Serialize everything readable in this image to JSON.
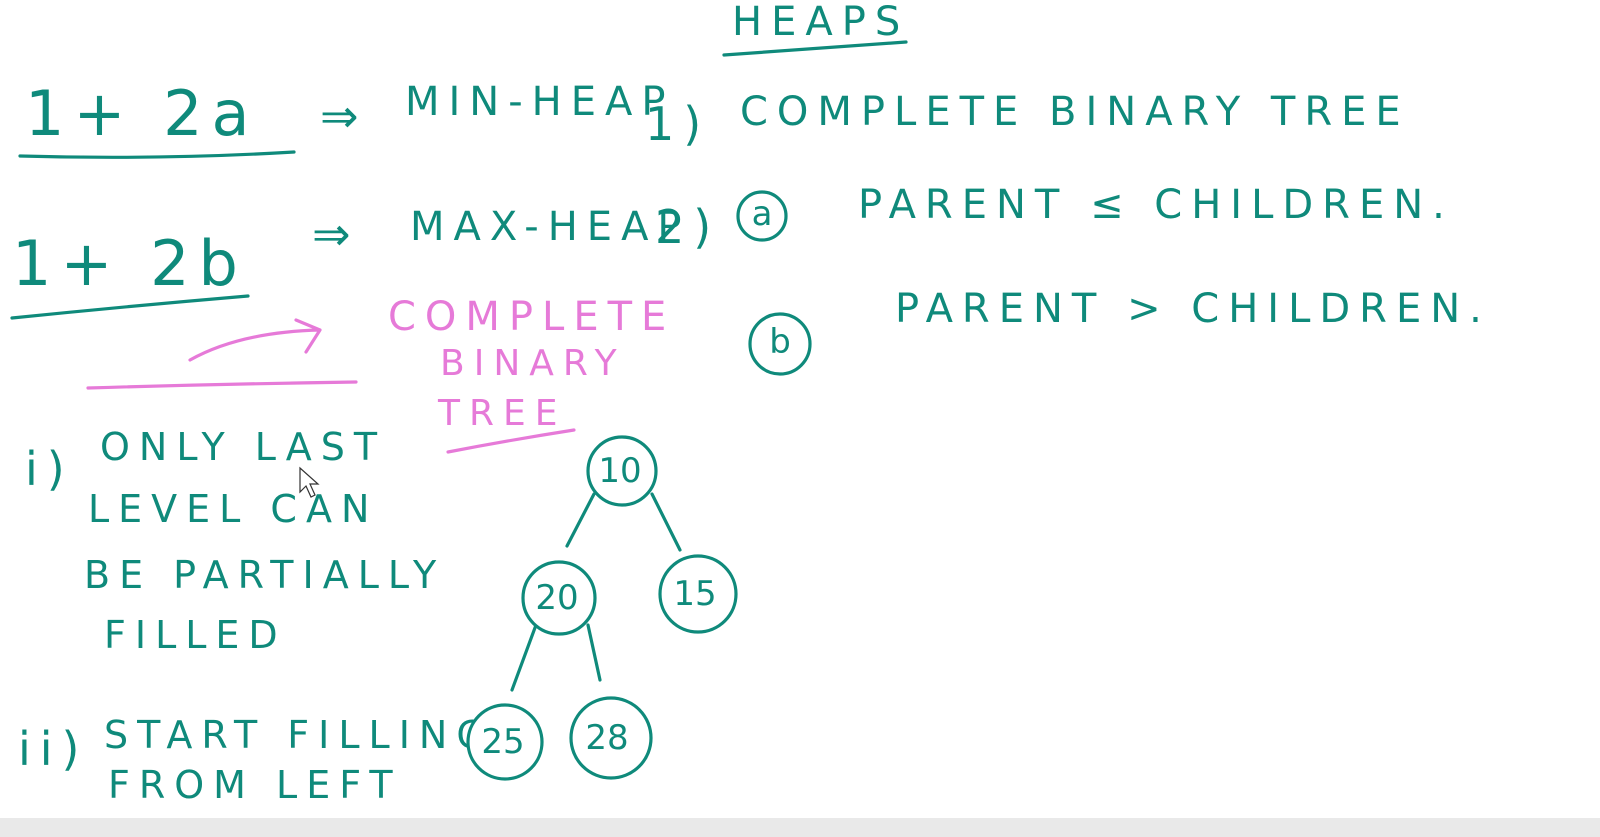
{
  "title": "HEAPS",
  "left": {
    "row1": {
      "term": "1+ 2a",
      "arrow": "⇒",
      "result": "MIN-HEAP"
    },
    "row2": {
      "term": "1+ 2b",
      "arrow": "⇒",
      "result": "MAX-HEAP"
    },
    "complete_label": [
      "COMPLETE",
      "BINARY",
      "TREE"
    ],
    "point_i_label": "i)",
    "point_i_lines": [
      "ONLY LAST",
      "LEVEL CAN",
      "BE PARTIALLY",
      "FILLED"
    ],
    "point_ii_label": "ii)",
    "point_ii_lines": [
      "START FILLING",
      "FROM LEFT"
    ]
  },
  "right": {
    "item1_label": "1)",
    "item1_text": "COMPLETE BINARY TREE",
    "item2_label": "2)",
    "item2a_badge": "a",
    "item2a_text": "PARENT ≤ CHILDREN.",
    "item2b_badge": "b",
    "item2b_text": "PARENT > CHILDREN."
  },
  "tree": {
    "root": "10",
    "left": "20",
    "right": "15",
    "left_left": "25",
    "left_right": "28"
  },
  "colors": {
    "ink": "#0f8a7b",
    "highlight": "#e67ad8"
  }
}
